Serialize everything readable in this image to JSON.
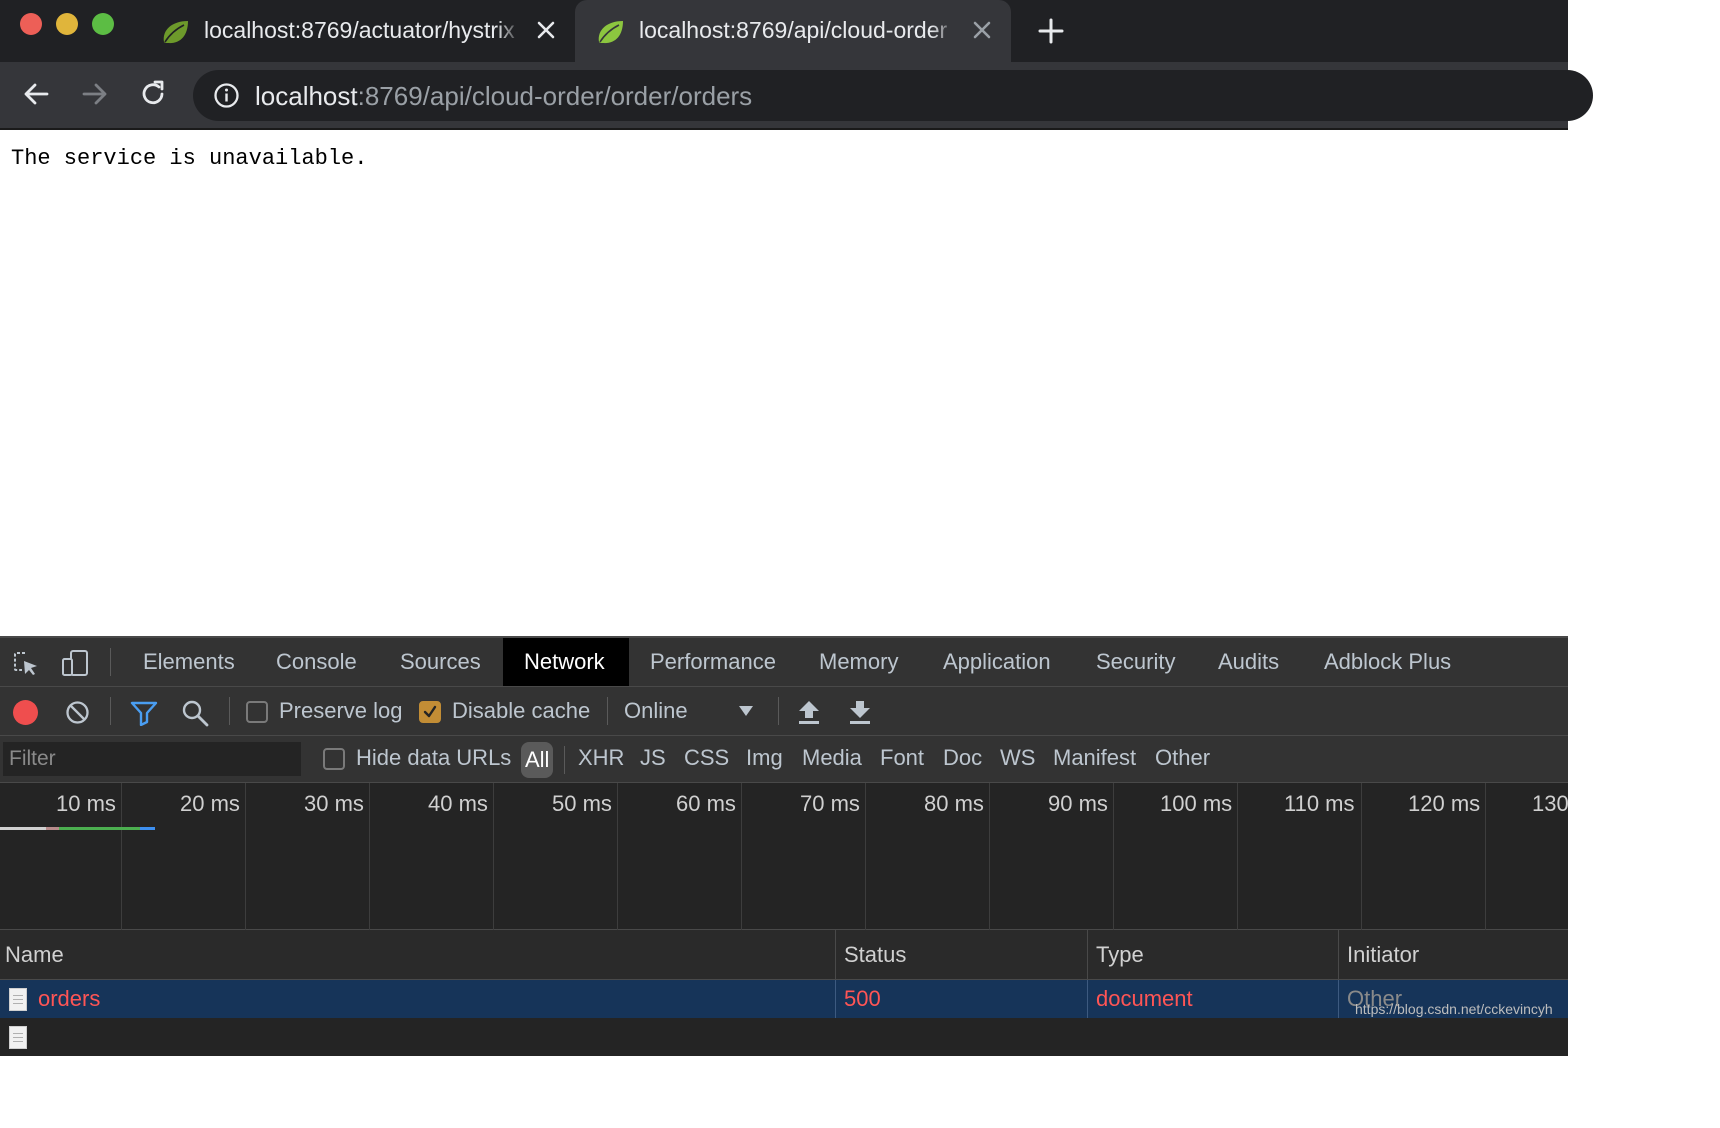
{
  "window": {
    "traffic_lights": {
      "close": "#ed5f57",
      "minimize": "#e0b53b",
      "maximize": "#5cbd44"
    }
  },
  "tabs": [
    {
      "title": "localhost:8769/actuator/hystrix",
      "active": false,
      "favicon": "spring-leaf-icon"
    },
    {
      "title": "localhost:8769/api/cloud-order",
      "active": true,
      "favicon": "spring-leaf-icon"
    }
  ],
  "toolbar": {
    "url_host": "localhost",
    "url_rest": ":8769/api/cloud-order/order/orders"
  },
  "page": {
    "body_text": "The service is unavailable."
  },
  "devtools": {
    "tabs": [
      "Elements",
      "Console",
      "Sources",
      "Network",
      "Performance",
      "Memory",
      "Application",
      "Security",
      "Audits",
      "Adblock Plus"
    ],
    "active_tab": "Network",
    "controls": {
      "preserve_log": {
        "label": "Preserve log",
        "checked": false
      },
      "disable_cache": {
        "label": "Disable cache",
        "checked": true
      },
      "throttling": "Online"
    },
    "filter": {
      "placeholder": "Filter",
      "hide_data_urls": "Hide data URLs",
      "types": [
        "All",
        "XHR",
        "JS",
        "CSS",
        "Img",
        "Media",
        "Font",
        "Doc",
        "WS",
        "Manifest",
        "Other"
      ],
      "active_type": "All"
    },
    "timeline_ticks": [
      "10 ms",
      "20 ms",
      "30 ms",
      "40 ms",
      "50 ms",
      "60 ms",
      "70 ms",
      "80 ms",
      "90 ms",
      "100 ms",
      "110 ms",
      "120 ms",
      "130"
    ],
    "table": {
      "columns": [
        "Name",
        "Status",
        "Type",
        "Initiator"
      ],
      "rows": [
        {
          "name": "orders",
          "status": "500",
          "type": "document",
          "initiator": "Other"
        }
      ]
    }
  },
  "watermark": "https://blog.csdn.net/cckevincyh"
}
